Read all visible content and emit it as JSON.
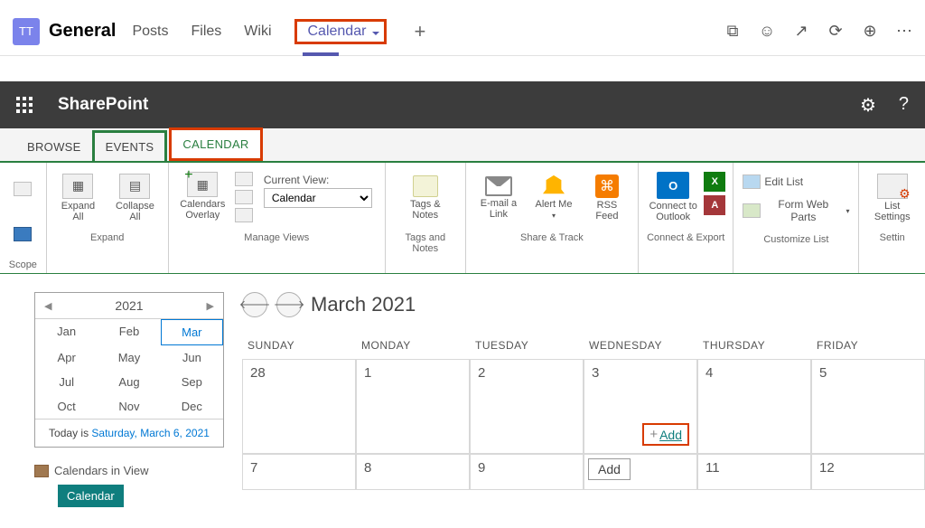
{
  "teams_header": {
    "avatar": "TT",
    "channel": "General",
    "tabs": {
      "posts": "Posts",
      "files": "Files",
      "wiki": "Wiki",
      "calendar": "Calendar"
    }
  },
  "sharepoint": {
    "title": "SharePoint"
  },
  "ribbon_tabs": {
    "browse": "BROWSE",
    "events": "EVENTS",
    "calendar": "CALENDAR"
  },
  "ribbon": {
    "scope": "Scope",
    "expand_all": "Expand All",
    "collapse_all": "Collapse All",
    "expand_group": "Expand",
    "calendars_overlay": "Calendars Overlay",
    "current_view_label": "Current View:",
    "current_view_value": "Calendar",
    "manage_views": "Manage Views",
    "tags_notes": "Tags & Notes",
    "tags_group": "Tags and Notes",
    "email_link": "E-mail a Link",
    "alert_me": "Alert Me",
    "rss_feed": "RSS Feed",
    "share_track": "Share & Track",
    "connect_outlook": "Connect to Outlook",
    "connect_export": "Connect & Export",
    "edit_list": "Edit List",
    "form_web_parts": "Form Web Parts",
    "customize_list": "Customize List",
    "list_settings": "List Settings",
    "settings_group": "Settin"
  },
  "mini_cal": {
    "year": "2021",
    "months": [
      "Jan",
      "Feb",
      "Mar",
      "Apr",
      "May",
      "Jun",
      "Jul",
      "Aug",
      "Sep",
      "Oct",
      "Nov",
      "Dec"
    ],
    "selected_index": 2,
    "today_prefix": "Today is ",
    "today_link": "Saturday, March 6, 2021"
  },
  "calendars_in_view": {
    "heading": "Calendars in View",
    "item": "Calendar"
  },
  "big_cal": {
    "title": "March 2021",
    "day_headers": [
      "SUNDAY",
      "MONDAY",
      "TUESDAY",
      "WEDNESDAY",
      "THURSDAY",
      "FRIDAY"
    ],
    "row1": [
      "28",
      "1",
      "2",
      "3",
      "4",
      "5"
    ],
    "row2": [
      "7",
      "8",
      "9",
      "",
      "11",
      "12"
    ],
    "add_label": "Add",
    "add_tooltip": "Add"
  }
}
